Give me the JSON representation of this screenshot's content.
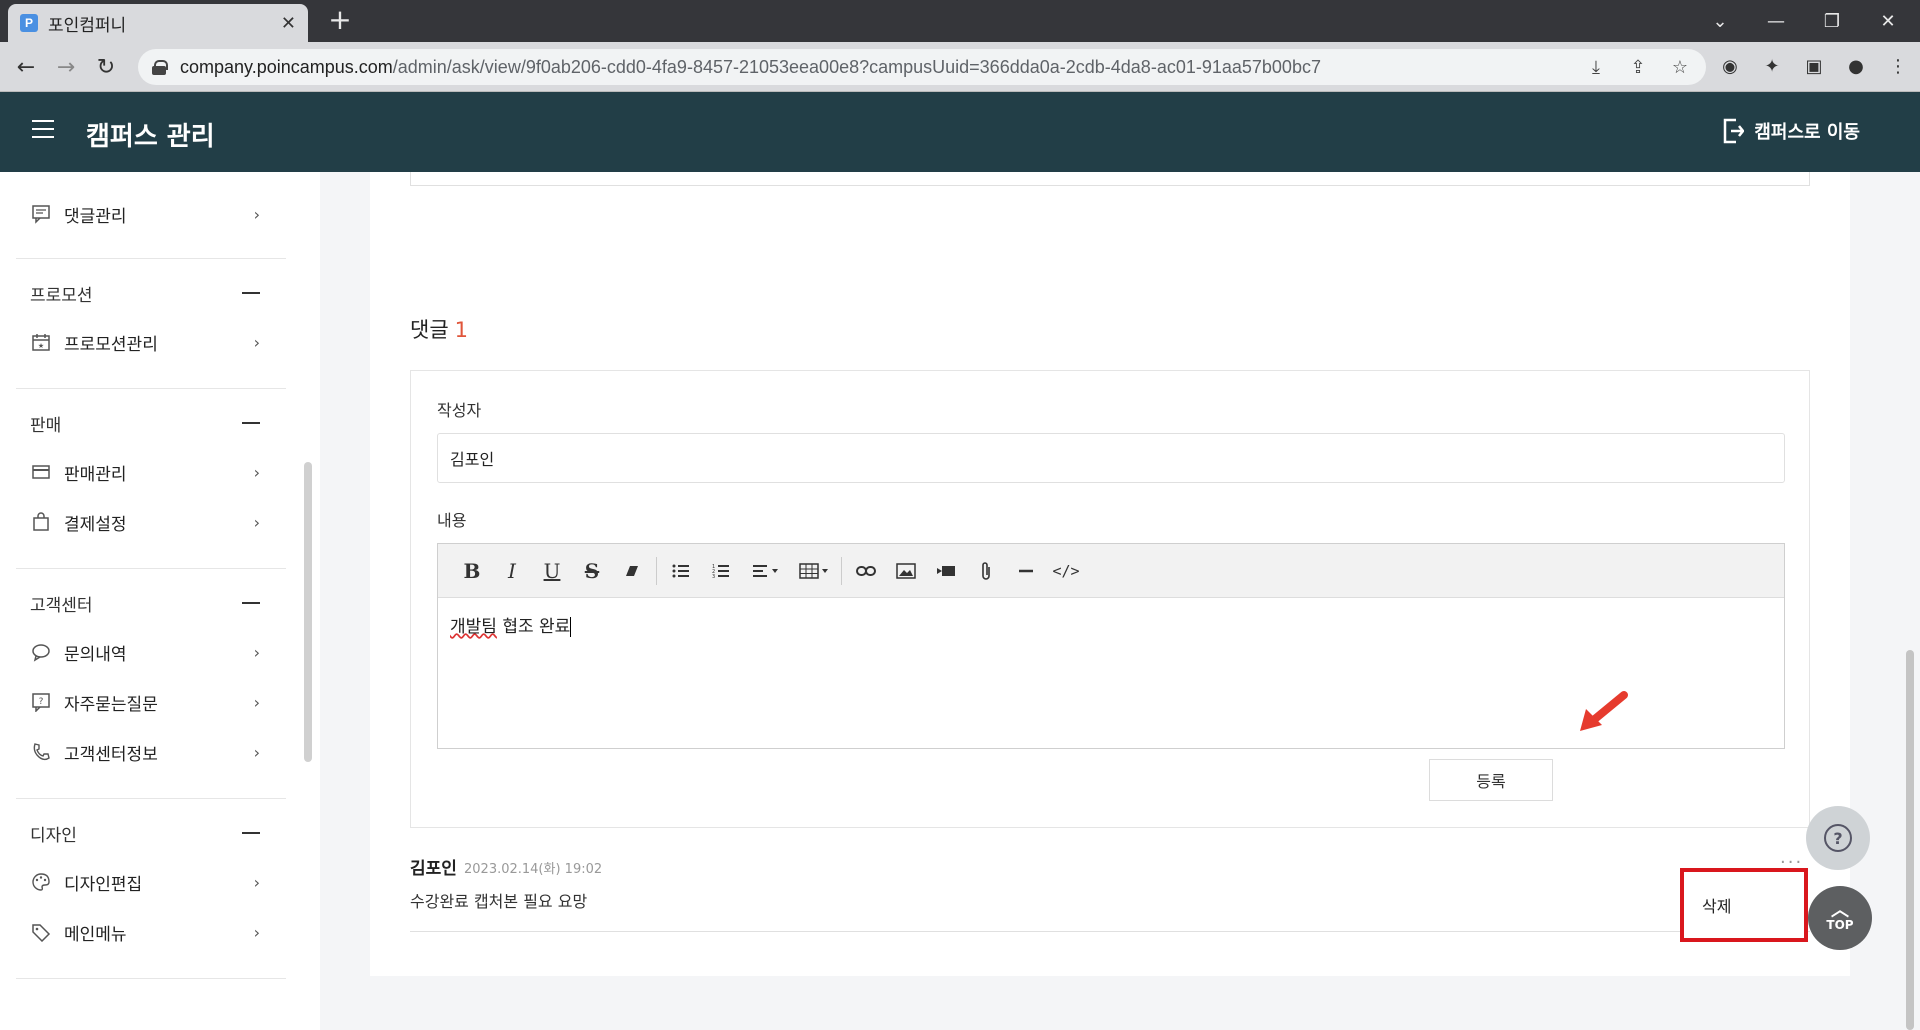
{
  "browser": {
    "tab_title": "포인컴퍼니",
    "tab_favicon": "P",
    "url_domain": "company.poincampus.com",
    "url_path": "/admin/ask/view/9f0ab206-cdd0-4fa9-8457-21053eea00e8?campusUuid=366dda0a-2cdb-4da8-ac01-91aa57b00bc7"
  },
  "header": {
    "title": "캠퍼스 관리",
    "goto_label": "캠퍼스로 이동"
  },
  "sidebar": {
    "top_item": "댓글관리",
    "sections": [
      {
        "title": "프로모션",
        "items": [
          "프로모션관리"
        ]
      },
      {
        "title": "판매",
        "items": [
          "판매관리",
          "결제설정"
        ]
      },
      {
        "title": "고객센터",
        "items": [
          "문의내역",
          "자주묻는질문",
          "고객센터정보"
        ]
      },
      {
        "title": "디자인",
        "items": [
          "디자인편집",
          "메인메뉴"
        ]
      }
    ]
  },
  "comments": {
    "title": "댓글",
    "count": "1",
    "form": {
      "author_label": "작성자",
      "author_value": "김포인",
      "content_label": "내용",
      "content_value_typo": "개발팀",
      "content_value_rest": " 협조 완료",
      "submit_label": "등록"
    },
    "entries": [
      {
        "author": "김포인",
        "date": "2023.02.14(화) 19:02",
        "text": "수강완료 캡처본 필요 요망",
        "more": "···"
      }
    ],
    "delete_label": "삭제"
  },
  "floating": {
    "help_icon": "?",
    "top_label": "TOP"
  },
  "colors": {
    "header_bg": "#223e47",
    "accent_count": "#e0553a",
    "highlight_red": "#d9171d"
  }
}
